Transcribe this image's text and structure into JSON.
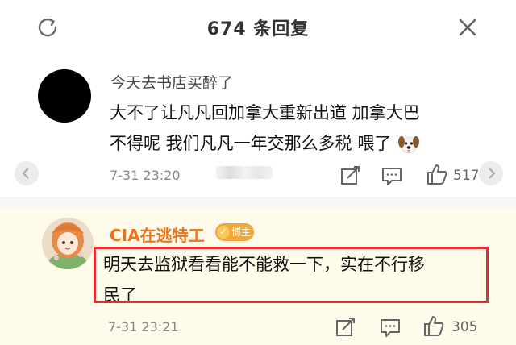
{
  "header": {
    "title": "674 条回复",
    "refresh_icon": "refresh-icon",
    "close_icon": "close-icon"
  },
  "comments": [
    {
      "username": "今天去书店买醉了",
      "text_line1": "大不了让凡凡回加拿大重新出道 加拿大巴",
      "text_line2": "不得呢 我们凡凡一年交那么多税 喂了",
      "emoji": "dog-emoji",
      "time": "7-31 23:20",
      "like_count": "517"
    },
    {
      "username": "CIA在逃特工",
      "badge": "博主",
      "text_line1": "明天去监狱看看能不能救一下，实在不行移",
      "text_line2": "民了",
      "time": "7-31 23:21",
      "like_count": "305"
    }
  ],
  "colors": {
    "accent": "#e8741e",
    "highlight_border": "#e03030",
    "badge_bg": "#f0a63a"
  }
}
